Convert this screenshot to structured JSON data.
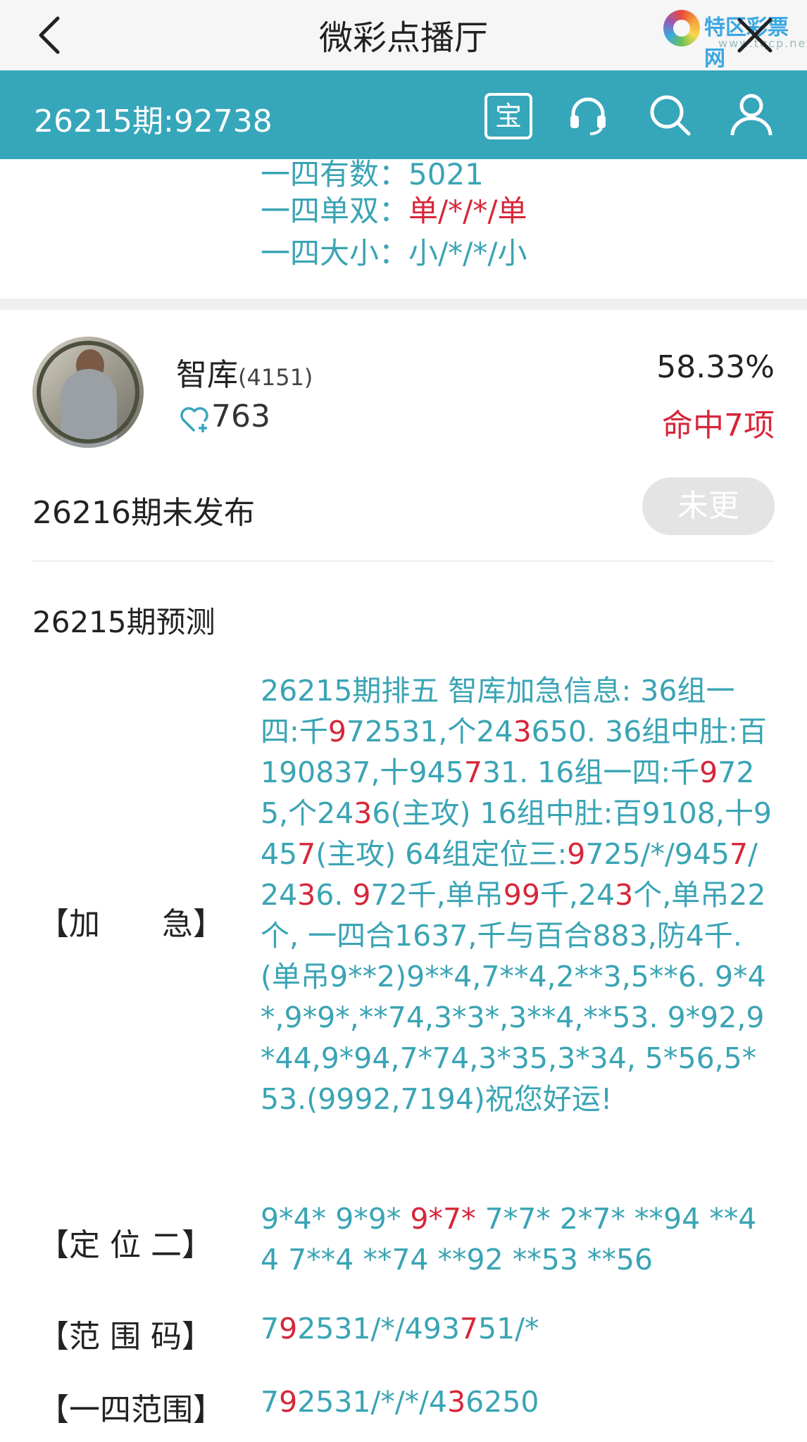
{
  "topbar": {
    "title": "微彩点播厅",
    "logo_brand": "特区彩票网",
    "logo_domain": "www.tqcp.net"
  },
  "infobar": {
    "period": "26215期:92738",
    "bao_label": "宝"
  },
  "previous": {
    "rows": [
      {
        "label": "一四有数：",
        "value": "5021"
      },
      {
        "label": "一四单双：",
        "value": "单/*/*/单"
      },
      {
        "label": "一四大小：",
        "value": "小/*/*/小"
      }
    ]
  },
  "expert": {
    "name": "智库",
    "id": "(4151)",
    "likes": "763",
    "hit_rate": "58.33%",
    "hits": "命中7项",
    "next_status": "26216期未发布",
    "next_button": "未更"
  },
  "prediction": {
    "header": "26215期预测",
    "items": [
      {
        "label": "【加　　急】",
        "segments": [
          {
            "t": "26215期排五 智库加急信息: 36组一四:千"
          },
          {
            "t": "9",
            "red": true
          },
          {
            "t": "72531,个24"
          },
          {
            "t": "3",
            "red": true
          },
          {
            "t": "650. 36组中肚:百190837,十945"
          },
          {
            "t": "7",
            "red": true
          },
          {
            "t": "31. 16组一四:千"
          },
          {
            "t": "9",
            "red": true
          },
          {
            "t": "725,个24"
          },
          {
            "t": "3",
            "red": true
          },
          {
            "t": "6(主攻) 16组中肚:百9108,十945"
          },
          {
            "t": "7",
            "red": true
          },
          {
            "t": "(主攻) 64组定位三:"
          },
          {
            "t": "9",
            "red": true
          },
          {
            "t": "725/*/945"
          },
          {
            "t": "7",
            "red": true
          },
          {
            "t": "/24"
          },
          {
            "t": "3",
            "red": true
          },
          {
            "t": "6. "
          },
          {
            "t": "9",
            "red": true
          },
          {
            "t": "72千,单吊"
          },
          {
            "t": "99",
            "red": true
          },
          {
            "t": "千,24"
          },
          {
            "t": "3",
            "red": true
          },
          {
            "t": "个,单吊22个, 一四合1637,千与百合883,防4千. (单吊9**2)9**4,7**4,2**3,5**6. 9*4*,9*9*,**74,3*3*,3**4,**53. 9*92,9*44,9*94,7*74,3*35,3*34, 5*56,5*53.(9992,7194)祝您好运!"
          }
        ]
      },
      {
        "label": "【定 位 二】",
        "segments": [
          {
            "t": "9*4* 9*9* "
          },
          {
            "t": "9*7*",
            "red": true
          },
          {
            "t": " 7*7* 2*7* **94 **44 7**4 **74 **92 **53 **56"
          }
        ]
      },
      {
        "label": "【范 围 码】",
        "segments": [
          {
            "t": "7"
          },
          {
            "t": "9",
            "red": true
          },
          {
            "t": "2531/*/493"
          },
          {
            "t": "7",
            "red": true
          },
          {
            "t": "51/*"
          }
        ]
      },
      {
        "label": "【一四范围】",
        "segments": [
          {
            "t": "7"
          },
          {
            "t": "9",
            "red": true
          },
          {
            "t": "2531/*/*/4"
          },
          {
            "t": "3",
            "red": true
          },
          {
            "t": "6250"
          }
        ]
      }
    ]
  }
}
